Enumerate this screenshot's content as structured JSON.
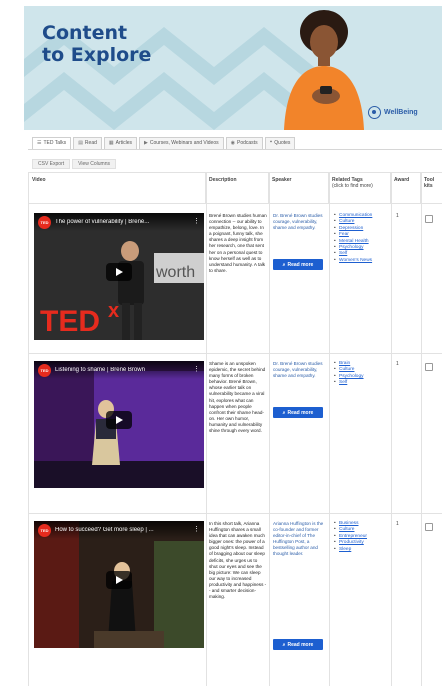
{
  "hero": {
    "title_line1": "Content",
    "title_line2": "to Explore",
    "brand": "WellBeing",
    "bg_color": "#cfe5eb",
    "title_color": "#1f4c8a",
    "shirt_color": "#f2842a"
  },
  "tabs": [
    {
      "icon": "list-icon",
      "label": "TED Talks",
      "active": true
    },
    {
      "icon": "book-icon",
      "label": "Read",
      "active": false
    },
    {
      "icon": "article-icon",
      "label": "Articles",
      "active": false
    },
    {
      "icon": "video-icon",
      "label": "Courses, Webinars and Videos",
      "active": false
    },
    {
      "icon": "podcast-icon",
      "label": "Podcasts",
      "active": false
    },
    {
      "icon": "quote-icon",
      "label": "Quotes",
      "active": false
    }
  ],
  "subbuttons": [
    "CSV Export",
    "View Columns"
  ],
  "columns": {
    "video": "Video",
    "description": "Description",
    "speaker": "Speaker",
    "tags": "Related Tags",
    "tags_sub": "(click to find more)",
    "award": "Award",
    "toolkit": "Tool kits"
  },
  "read_more": "Read more",
  "rows": [
    {
      "video_title": "The power of vulnerability | Brené...",
      "description": "Brené Brown studies human connection -- our ability to empathize, belong, love. In a poignant, funny talk, she shares a deep insight from her research, one that sent her on a personal quest to know herself as well as to understand humanity. A talk to share.",
      "speaker": "Dr. Brené Brown studies courage, vulnerability, shame and empathy.",
      "tags": [
        "Communication",
        "Culture",
        "Depression",
        "Fear",
        "Mental Health",
        "Psychology",
        "Self",
        "Women's News"
      ],
      "award": "1"
    },
    {
      "video_title": "Listening to shame | Brené Brown",
      "description": "Shame is an unspoken epidemic, the secret behind many forms of broken behavior. Brené Brown, whose earlier talk on vulnerability became a viral hit, explores what can happen when people confront their shame head-on. Her own humor, humanity and vulnerability shine through every word.",
      "speaker": "Dr. Brené Brown studies courage, vulnerability, shame and empathy.",
      "tags": [
        "Brain",
        "Culture",
        "Psychology",
        "Self"
      ],
      "award": "1"
    },
    {
      "video_title": "How to succeed? Get more sleep | ...",
      "description": "In this short talk, Arianna Huffington shares a small idea that can awaken much bigger ones: the power of a good night's sleep. Instead of bragging about our sleep deficits, she urges us to shut our eyes and see the big picture: We can sleep our way to increased productivity and happiness -- and smarter decision-making.",
      "speaker": "Arianna Huffington is the co-founder and former editor-in-chief of The Huffington Post, a bestselling author and thought leader.",
      "tags": [
        "Business",
        "Culture",
        "Entrepreneur",
        "Productivity",
        "Sleep"
      ],
      "award": "1"
    }
  ]
}
